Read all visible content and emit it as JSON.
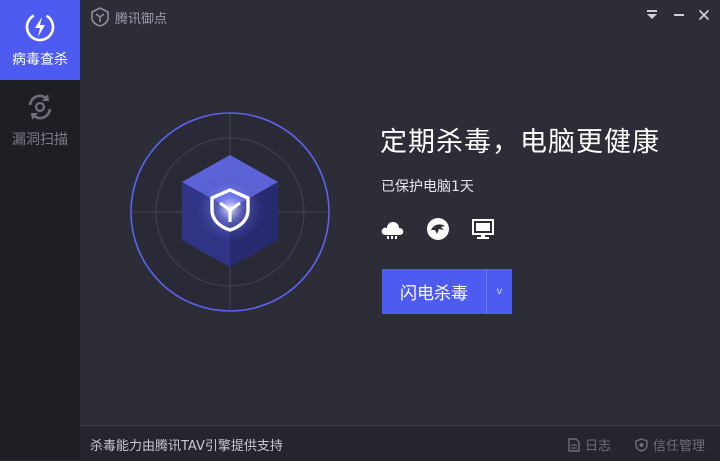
{
  "app": {
    "title": "腾讯御点"
  },
  "sidebar": {
    "items": [
      {
        "label": "病毒查杀",
        "icon": "lightning-icon",
        "active": true
      },
      {
        "label": "漏洞扫描",
        "icon": "refresh-icon",
        "active": false
      }
    ]
  },
  "main": {
    "headline": "定期杀毒，电脑更健康",
    "protected_text": "已保护电脑1天",
    "status_icons": [
      "cloud-icon",
      "eagle-icon",
      "monitor-icon"
    ],
    "scan_button_label": "闪电杀毒",
    "scan_dropdown_glyph": "v"
  },
  "footer": {
    "engine_text": "杀毒能力由腾讯TAV引擎提供支持",
    "log_label": "日志",
    "trust_label": "信任管理"
  },
  "colors": {
    "accent": "#4d5bf0",
    "sidebar_bg": "#1e1e25",
    "main_bg": "#2d2d38"
  }
}
